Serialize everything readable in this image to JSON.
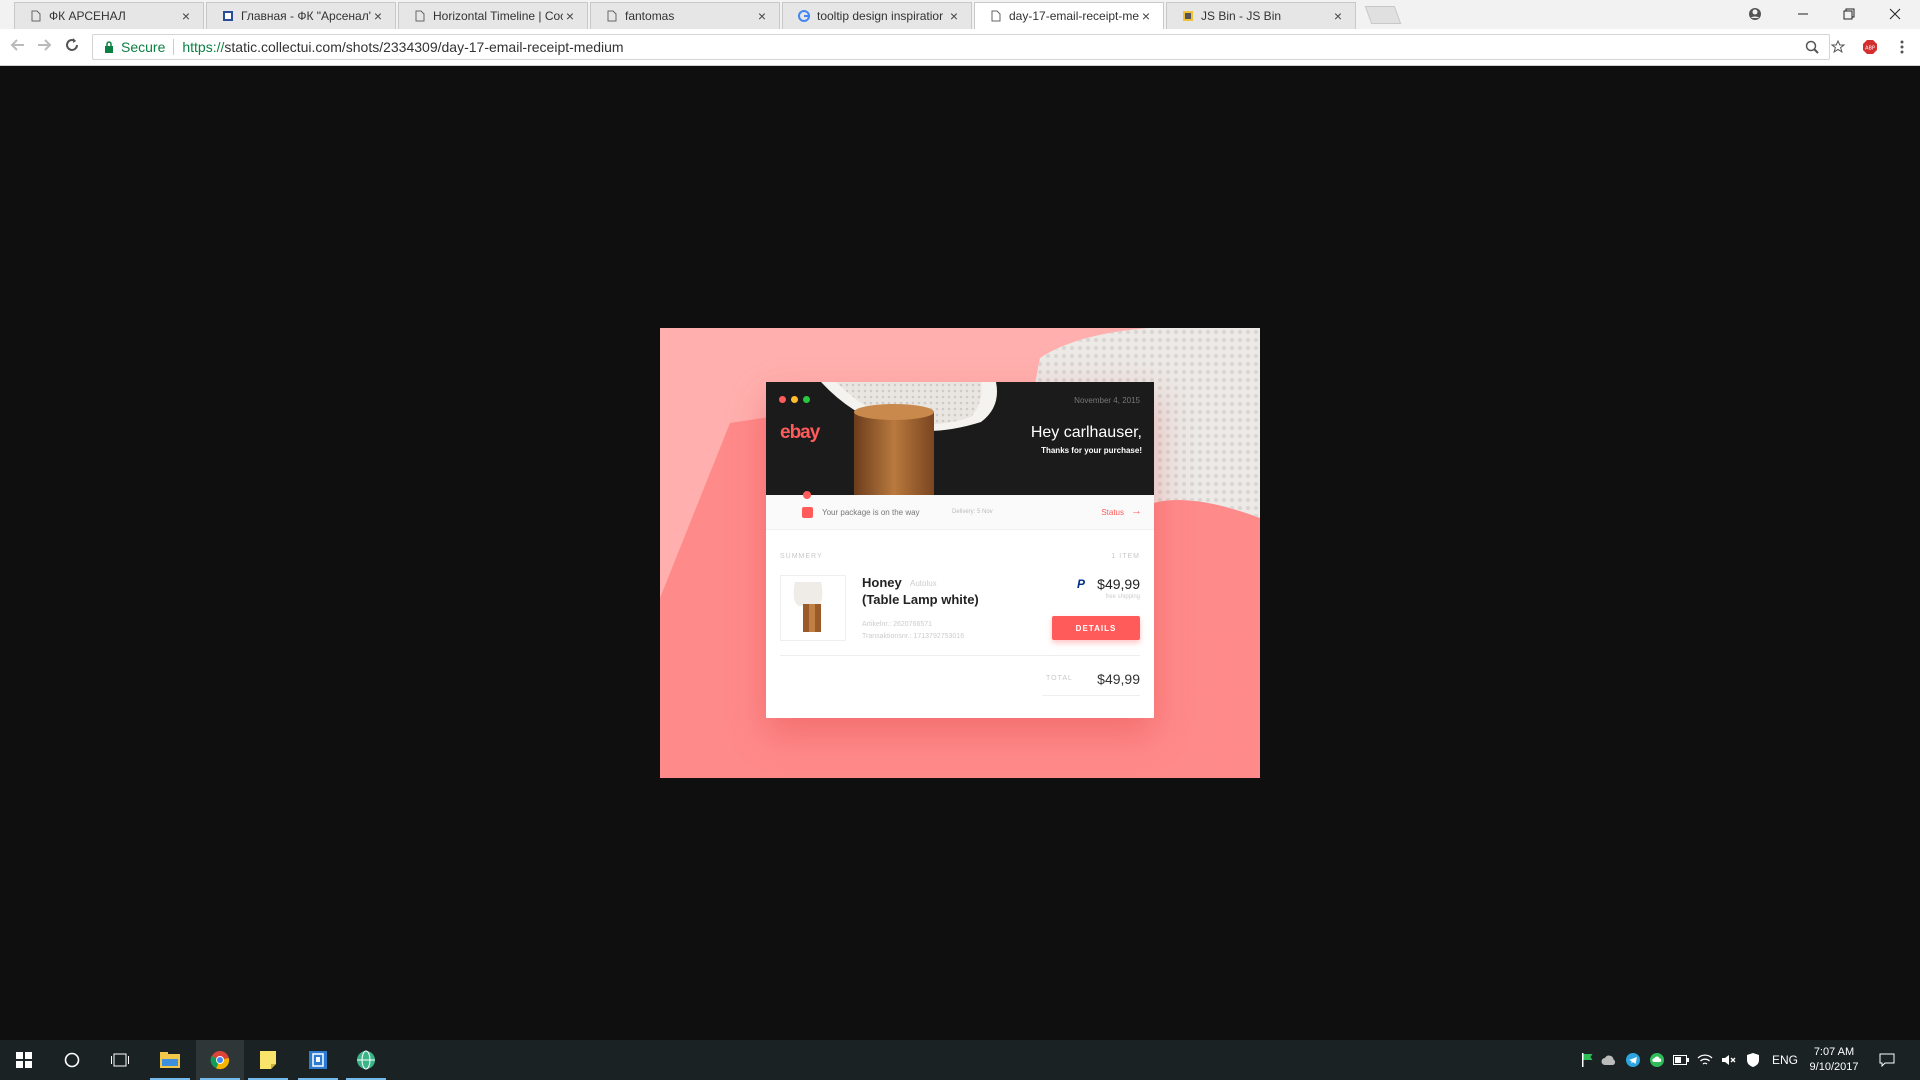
{
  "browser": {
    "tabs": [
      {
        "title": "ФК АРСЕНАЛ",
        "icon": "page-icon"
      },
      {
        "title": "Главная - ФК \"Арсенал\"",
        "icon": "site-icon"
      },
      {
        "title": "Horizontal Timeline | Coc",
        "icon": "page-icon"
      },
      {
        "title": "fantomas",
        "icon": "page-icon"
      },
      {
        "title": "tooltip design inspiratior",
        "icon": "google-icon"
      },
      {
        "title": "day-17-email-receipt-me",
        "icon": "page-icon",
        "active": true
      },
      {
        "title": "JS Bin - JS Bin",
        "icon": "jsbin-icon"
      }
    ],
    "tab_close": "×",
    "address": {
      "secure_label": "Secure",
      "url_scheme": "https://",
      "url_rest": "static.collectui.com/shots/2334309/day-17-email-receipt-medium"
    }
  },
  "receipt": {
    "brand": "ebay",
    "date": "November 4, 2015",
    "greeting": "Hey carlhauser,",
    "thanks": "Thanks for your purchase!",
    "status_text": "Your package is on the way",
    "delivery_text": "Delivery: 5 Nov",
    "status_link": "Status",
    "status_arrow": "→",
    "summary_label": "SUMMERY",
    "items_count": "1 ITEM",
    "product_name": "Honey",
    "product_brand": "Autolux",
    "product_subtitle": "(Table Lamp white)",
    "article": "Artikelnr.: 2620766571",
    "transaction": "Transaktionsnr.: 1713792753016",
    "paypal_mark": "P",
    "price": "$49,99",
    "shipping": "free shipping",
    "details_button": "DETAILS",
    "total_label": "TOTAL",
    "total_value": "$49,99",
    "colors": {
      "accent": "#ff5b5b",
      "background": "#ffa2a0",
      "header": "#1b1b1b"
    }
  },
  "taskbar": {
    "language": "ENG",
    "time": "7:07 AM",
    "date": "9/10/2017"
  }
}
